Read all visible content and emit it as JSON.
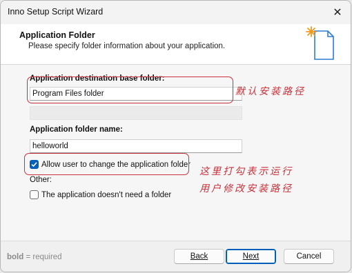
{
  "window": {
    "title": "Inno Setup Script Wizard"
  },
  "header": {
    "title": "Application Folder",
    "subtitle": "Please specify folder information about your application."
  },
  "base_folder": {
    "label": "Application destination base folder:",
    "value": "Program Files folder"
  },
  "folder_name": {
    "label": "Application folder name:",
    "value": "helloworld"
  },
  "allow_change": {
    "label": "Allow user to change the application folder",
    "checked": true
  },
  "other": {
    "label": "Other:",
    "no_folder_label": "The application doesn't need a folder",
    "no_folder_checked": false
  },
  "annotations": {
    "default_path": "默认安装路径",
    "line1": "这里打勾表示运行",
    "line2": "用户修改安装路径",
    "color": "#c8313a"
  },
  "footer": {
    "note_bold": "bold",
    "note_rest": " = required",
    "back_label": "Back",
    "next_label": "Next",
    "cancel_label": "Cancel"
  },
  "colors": {
    "accent": "#005fb8"
  }
}
